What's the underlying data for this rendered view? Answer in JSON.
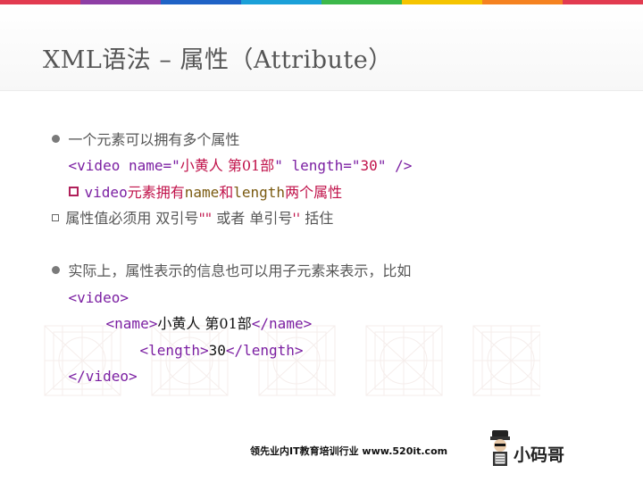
{
  "title": "XML语法 – 属性（Attribute）",
  "rainbow_colors": [
    "#e23b50",
    "#8e3ea5",
    "#1f63c6",
    "#1ba0d8",
    "#3cb84a",
    "#f5c400",
    "#f58220",
    "#e23b50"
  ],
  "lines": {
    "l1": {
      "text": "一个元素可以拥有多个属性"
    },
    "l2": {
      "open": "<video name=\"",
      "value": "小黄人 第01部",
      "mid": "\" length=\"",
      "num": "30",
      "close": "\" />"
    },
    "l3": {
      "a": "video",
      "b": "元素拥有",
      "c": "name",
      "d": "和",
      "e": "length",
      "f": "两个属性"
    },
    "l4": {
      "a": "属性值必须用 双引号",
      "b": "\"\"",
      "c": " 或者 单引号",
      "d": "''",
      "e": " 括住"
    },
    "l5": {
      "text": "实际上，属性表示的信息也可以用子元素来表示，比如"
    },
    "l6": {
      "tag": "<video>"
    },
    "l7": {
      "open": "<name>",
      "value": "小黄人 第01部",
      "close": "</name>"
    },
    "l8": {
      "open": "<length>",
      "value": "30",
      "close": "</length>"
    },
    "l9": {
      "tag": "</video>"
    }
  },
  "footer": {
    "text": "领先业内IT教育培训行业 www.520it.com"
  },
  "logo": {
    "text": "小码哥"
  }
}
